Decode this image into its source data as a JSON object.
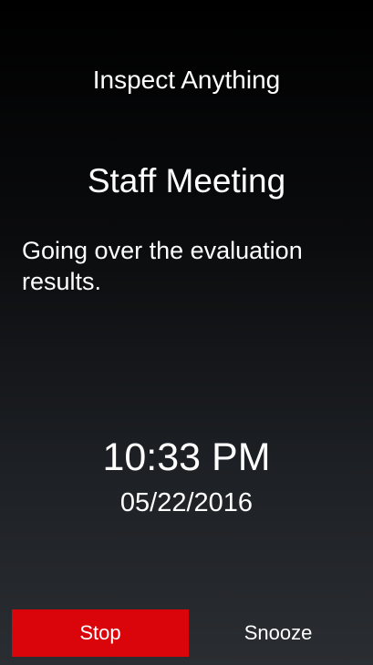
{
  "app": {
    "title": "Inspect Anything"
  },
  "event": {
    "title": "Staff Meeting",
    "description": "Going over the evaluation results."
  },
  "alarm": {
    "time": "10:33 PM",
    "date": "05/22/2016"
  },
  "actions": {
    "stop_label": "Stop",
    "snooze_label": "Snooze"
  },
  "colors": {
    "stop_button": "#d9050b",
    "background_top": "#000000",
    "background_bottom": "#2a2d31",
    "text": "#ffffff"
  }
}
